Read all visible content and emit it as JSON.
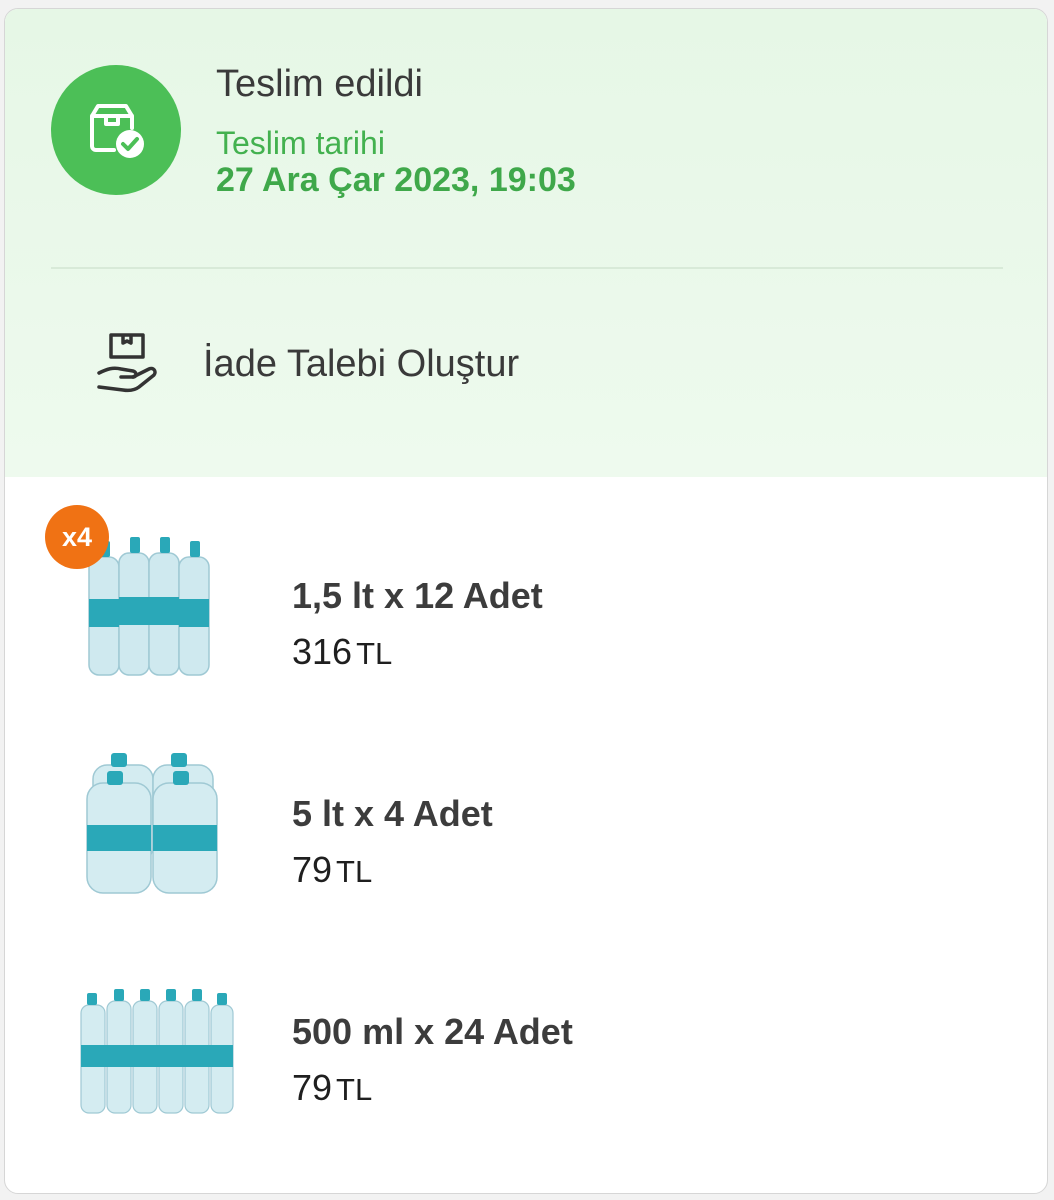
{
  "order": {
    "status_title": "Teslim edildi",
    "delivery_label": "Teslim tarihi",
    "delivery_date": "27 Ara Çar 2023, 19:03",
    "return_action": "İade Talebi Oluştur"
  },
  "items": [
    {
      "name": "1,5 lt x 12 Adet",
      "price": "316",
      "currency": "TL",
      "quantity_badge": "x4",
      "image_icon": "water-pack-1-5l-icon"
    },
    {
      "name": "5 lt x 4 Adet",
      "price": "79",
      "currency": "TL",
      "image_icon": "water-pack-5l-icon"
    },
    {
      "name": "500 ml x 24 Adet",
      "price": "79",
      "currency": "TL",
      "image_icon": "water-pack-500ml-icon"
    }
  ],
  "colors": {
    "status_green": "#4cbf57",
    "date_green": "#3fa84a",
    "badge_orange": "#f07214",
    "header_bg": "#e8f8e8"
  }
}
